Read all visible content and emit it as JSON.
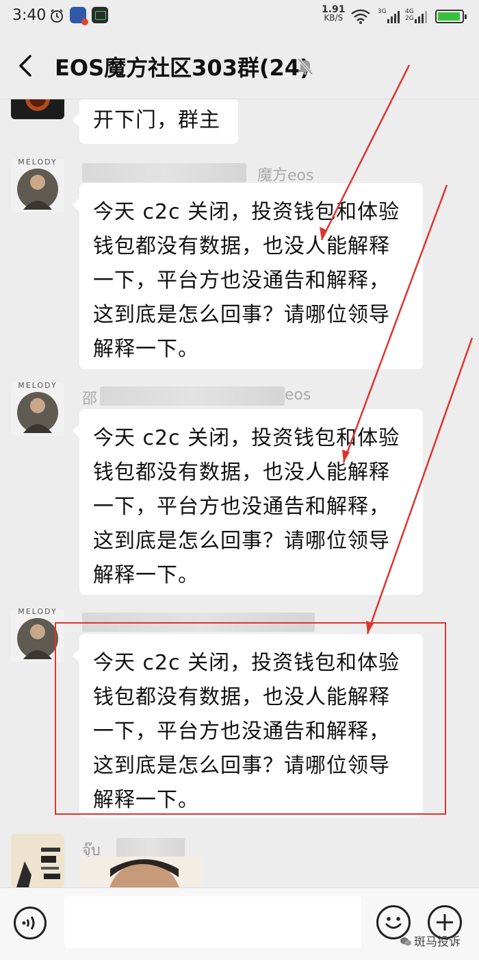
{
  "status_bar": {
    "time": "3:40",
    "net_speed_value": "1.91",
    "net_speed_unit": "KB/S",
    "sim1_label": "3G",
    "sim2_label_top": "4G",
    "sim2_label_bottom": "2G",
    "battery_level": 0.95,
    "battery_color": "#37c23a"
  },
  "header": {
    "title": "EOS魔方社区303群(24)",
    "back_icon": "chevron-left-icon",
    "mute_icon": "bell-off-icon"
  },
  "messages": [
    {
      "sender_visible": "",
      "text": "开下门，群主"
    },
    {
      "sender_visible": "魔方eos",
      "text": "今天 c2c 关闭，投资钱包和体验钱包都没有数据，也没人能解释一下，平台方也没通告和解释，这到底是怎么回事？请哪位领导解释一下。"
    },
    {
      "sender_visible_prefix": "邵",
      "sender_visible": "eos",
      "text": "今天 c2c 关闭，投资钱包和体验钱包都没有数据，也没人能解释一下，平台方也没通告和解释，这到底是怎么回事？请哪位领导解释一下。"
    },
    {
      "sender_visible": "",
      "text": "今天 c2c 关闭，投资钱包和体验钱包都没有数据，也没人能解释一下，平台方也没通告和解释，这到底是怎么回事？请哪位领导解释一下。"
    },
    {
      "sender_visible": "จุ๊บ"
    }
  ],
  "avatar_caption": "MELODY",
  "input_bar": {
    "placeholder": "",
    "voice_icon": "voice-icon",
    "emoji_icon": "emoji-icon",
    "plus_icon": "plus-icon"
  },
  "watermark": {
    "text": "斑马投诉"
  },
  "colors": {
    "background": "#ededed",
    "bubble": "#ffffff",
    "annotation_red": "#e0322c"
  }
}
